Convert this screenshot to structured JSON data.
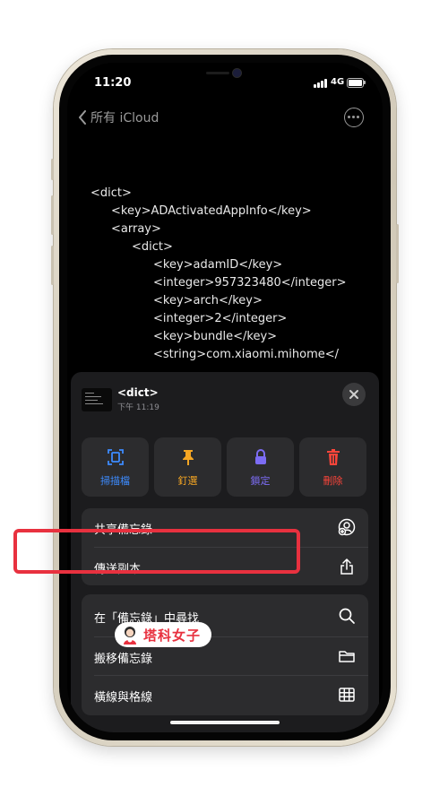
{
  "status": {
    "time": "11:20",
    "network": "4G"
  },
  "nav": {
    "back_label": "所有 iCloud",
    "back_icon": "chevron-left-icon",
    "more_icon": "ellipsis-circle-icon"
  },
  "note_lines": [
    "<dict>",
    "<key>ADActivatedAppInfo</key>",
    "<array>",
    "<dict>",
    "<key>adamID</key>",
    "<integer>957323480</integer>",
    "<key>arch</key>",
    "<integer>2</integer>",
    "<key>bundle</key>",
    "<string>com.xiaomi.mihome</"
  ],
  "sheet": {
    "title": "<dict>",
    "subtitle": "下午 11:19",
    "actions": [
      {
        "label": "掃描檔",
        "icon": "scan-document-icon",
        "color": "#3d8bff"
      },
      {
        "label": "釘選",
        "icon": "pin-icon",
        "color": "#f5a623"
      },
      {
        "label": "鎖定",
        "icon": "lock-icon",
        "color": "#7c6cf4"
      },
      {
        "label": "刪除",
        "icon": "trash-icon",
        "color": "#ff453a"
      }
    ],
    "menu1": [
      {
        "label": "共享備忘錄",
        "icon": "share-person-icon"
      },
      {
        "label": "傳送副本",
        "icon": "share-upload-icon"
      }
    ],
    "menu2": [
      {
        "label": "在「備忘錄」中尋找",
        "icon": "search-icon",
        "highlighted": true
      },
      {
        "label": "搬移備忘錄",
        "icon": "folder-icon"
      },
      {
        "label": "橫線與格線",
        "icon": "grid-icon"
      }
    ]
  },
  "watermark": {
    "text": "塔科女子",
    "color": "#e8313f"
  }
}
